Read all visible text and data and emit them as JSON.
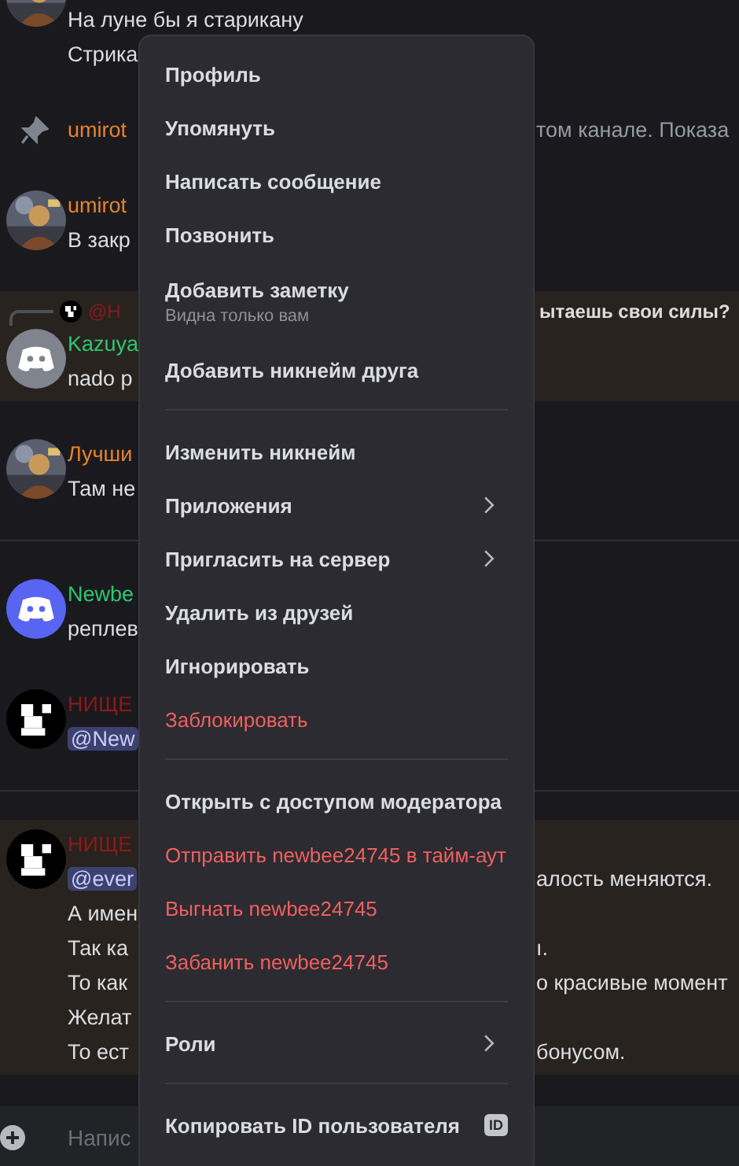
{
  "chat": {
    "messages": [
      {
        "kind": "message",
        "avatar": {
          "kind": "picture"
        },
        "lines": [
          {
            "left": "На луне бы я старикану"
          },
          {
            "left": "Стрика"
          }
        ]
      },
      {
        "kind": "system",
        "author": {
          "name": "umirot",
          "color": "#e8832b"
        },
        "right": "том канале. Показа"
      },
      {
        "kind": "message",
        "highlighted": false,
        "avatar": {
          "kind": "picture"
        },
        "author": {
          "name": "umirot",
          "color": "#e8832b"
        },
        "lines": [
          {
            "left": "В закр"
          }
        ]
      },
      {
        "kind": "message",
        "highlighted": true,
        "reply": {
          "mention": "@Н",
          "right": "ытаешь свои силы?"
        },
        "avatar": {
          "kind": "logo",
          "color": "#80848e"
        },
        "author": {
          "name": "Kazuya",
          "color": "#2dc770"
        },
        "lines": [
          {
            "left": "nado р"
          }
        ]
      },
      {
        "kind": "message",
        "highlighted": false,
        "avatar": {
          "kind": "picture"
        },
        "author": {
          "name": "Лучши",
          "color": "#e8832b"
        },
        "lines": [
          {
            "left": "Там не"
          }
        ]
      },
      {
        "kind": "divider"
      },
      {
        "kind": "message",
        "highlighted": false,
        "avatar": {
          "kind": "logo",
          "color": "#5865f2"
        },
        "author": {
          "name": "Newbe",
          "color": "#2dc770"
        },
        "lines": [
          {
            "left": "реплев"
          }
        ]
      },
      {
        "kind": "message",
        "highlighted": false,
        "avatar": {
          "kind": "pixel"
        },
        "author": {
          "name": "НИЩЕ",
          "color": "#8b1a1a"
        },
        "lines": [
          {
            "mention": "@New"
          }
        ]
      },
      {
        "kind": "divider"
      },
      {
        "kind": "message",
        "highlighted": true,
        "avatar": {
          "kind": "pixel"
        },
        "author": {
          "name": "НИЩЕ",
          "color": "#8b1a1a"
        },
        "lines": [
          {
            "mention": "@ever",
            "right": "алость меняются."
          },
          {
            "left": "А имен"
          },
          {
            "left": "Так ка",
            "right": "ı."
          },
          {
            "left": "То как",
            "right": "о красивые момент"
          },
          {
            "left": "Желат"
          },
          {
            "left": "То ест",
            "right": "бонусом."
          }
        ]
      }
    ],
    "composer": {
      "placeholder": "Напис"
    }
  },
  "context_menu": {
    "items": [
      {
        "kind": "item",
        "label": "Профиль",
        "danger": false
      },
      {
        "kind": "item",
        "label": "Упомянуть",
        "danger": false
      },
      {
        "kind": "item",
        "label": "Написать сообщение",
        "danger": false
      },
      {
        "kind": "item",
        "label": "Позвонить",
        "danger": false
      },
      {
        "kind": "item",
        "label": "Добавить заметку",
        "subtitle": "Видна только вам",
        "danger": false
      },
      {
        "kind": "item",
        "label": "Добавить никнейм друга",
        "danger": false
      },
      {
        "kind": "separator"
      },
      {
        "kind": "item",
        "label": "Изменить никнейм",
        "danger": false
      },
      {
        "kind": "item",
        "label": "Приложения",
        "danger": false,
        "submenu": true
      },
      {
        "kind": "item",
        "label": "Пригласить на сервер",
        "danger": false,
        "submenu": true
      },
      {
        "kind": "item",
        "label": "Удалить из друзей",
        "danger": false
      },
      {
        "kind": "item",
        "label": "Игнорировать",
        "danger": false
      },
      {
        "kind": "item",
        "label": "Заблокировать",
        "danger": true
      },
      {
        "kind": "separator"
      },
      {
        "kind": "item",
        "label": "Открыть с доступом модератора",
        "danger": false
      },
      {
        "kind": "item",
        "label": "Отправить newbee24745 в тайм-аут",
        "danger": true
      },
      {
        "kind": "item",
        "label": "Выгнать newbee24745",
        "danger": true
      },
      {
        "kind": "item",
        "label": "Забанить newbee24745",
        "danger": true
      },
      {
        "kind": "separator"
      },
      {
        "kind": "item",
        "label": "Роли",
        "danger": false,
        "submenu": true
      },
      {
        "kind": "separator"
      },
      {
        "kind": "item",
        "label": "Копировать ID пользователя",
        "danger": false,
        "badge": "ID"
      }
    ]
  }
}
